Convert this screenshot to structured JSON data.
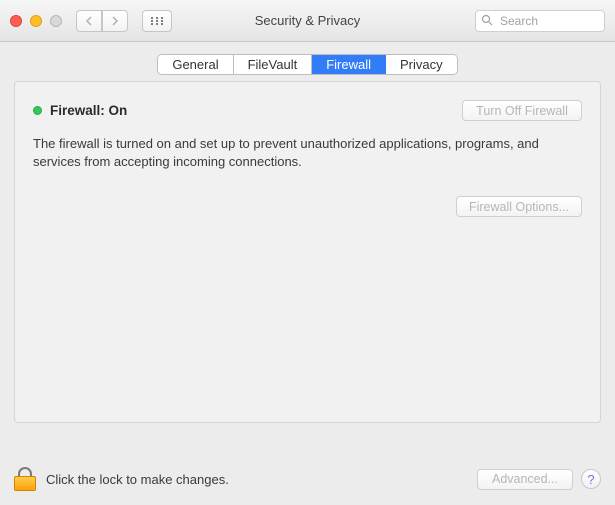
{
  "window": {
    "title": "Security & Privacy"
  },
  "search": {
    "placeholder": "Search"
  },
  "tabs": {
    "general": "General",
    "filevault": "FileVault",
    "firewall": "Firewall",
    "privacy": "Privacy"
  },
  "firewall": {
    "status_label": "Firewall: On",
    "turn_off_label": "Turn Off Firewall",
    "description": "The firewall is turned on and set up to prevent unauthorized applications, programs, and services from accepting incoming connections.",
    "options_label": "Firewall Options..."
  },
  "footer": {
    "lock_text": "Click the lock to make changes.",
    "advanced_label": "Advanced...",
    "help_label": "?"
  }
}
